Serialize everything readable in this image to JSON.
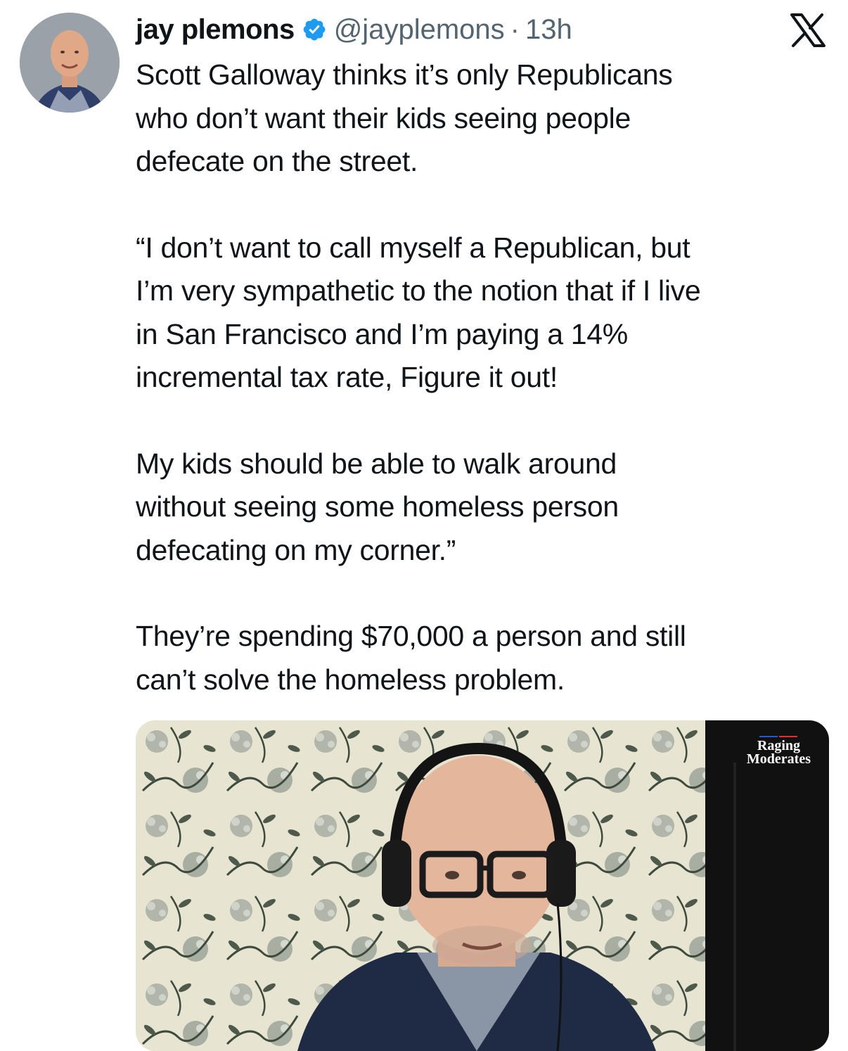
{
  "tweet": {
    "author_name": "jay plemons",
    "handle": "@jayplemons",
    "separator": "·",
    "time": "13h",
    "paragraphs": [
      "Scott Galloway thinks it’s only Republicans\nwho don’t want their kids seeing people\ndefecate on the street.",
      "“I don’t want to call myself a Republican, but\nI’m very sympathetic to the notion that if I live\nin San Francisco and I’m paying a 14%\nincremental tax rate, Figure it out!",
      "My kids should be able to walk around\nwithout seeing some homeless person\ndefecating on my corner.”",
      "They’re spending $70,000 a person and still\ncan’t solve the homeless problem."
    ]
  },
  "media": {
    "watermark_line1": "Raging",
    "watermark_line2": "Moderates"
  },
  "colors": {
    "text": "#0f1419",
    "secondary": "#536471",
    "verified_blue": "#1d9bf0"
  },
  "icons": {
    "verified": "verified-badge-icon",
    "platform": "x-logo-icon"
  }
}
